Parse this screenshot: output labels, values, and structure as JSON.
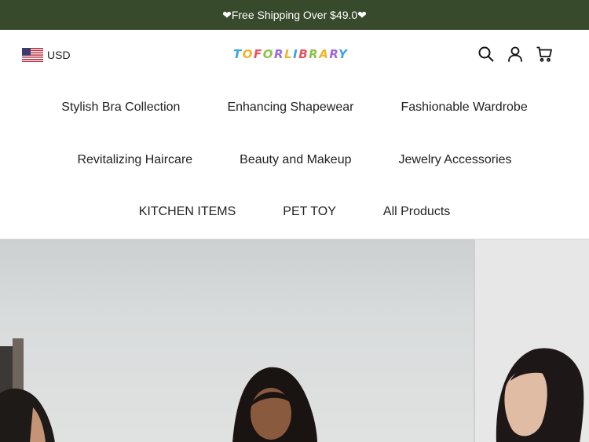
{
  "announcement": {
    "text": "❤Free Shipping Over $49.0❤"
  },
  "currency": {
    "code": "USD"
  },
  "logo": {
    "text": "TOFORLIBRARY"
  },
  "icons": {
    "search": "search-icon",
    "account": "user-icon",
    "cart": "cart-icon"
  },
  "nav": {
    "row1": [
      "Stylish Bra Collection",
      "Enhancing Shapewear",
      "Fashionable Wardrobe"
    ],
    "row2": [
      "Revitalizing Haircare",
      "Beauty and Makeup",
      "Jewelry Accessories"
    ],
    "row3": [
      "KITCHEN ITEMS",
      "PET TOY",
      "All Products"
    ]
  },
  "colors": {
    "announcement_bg": "#384a2c",
    "logo_letters": [
      "#3aa0e6",
      "#f0b429",
      "#e8505b",
      "#8bc34a",
      "#9c6ade",
      "#f0b429",
      "#3aa0e6",
      "#e8505b",
      "#8bc34a",
      "#f0b429",
      "#9c6ade",
      "#3aa0e6"
    ]
  }
}
